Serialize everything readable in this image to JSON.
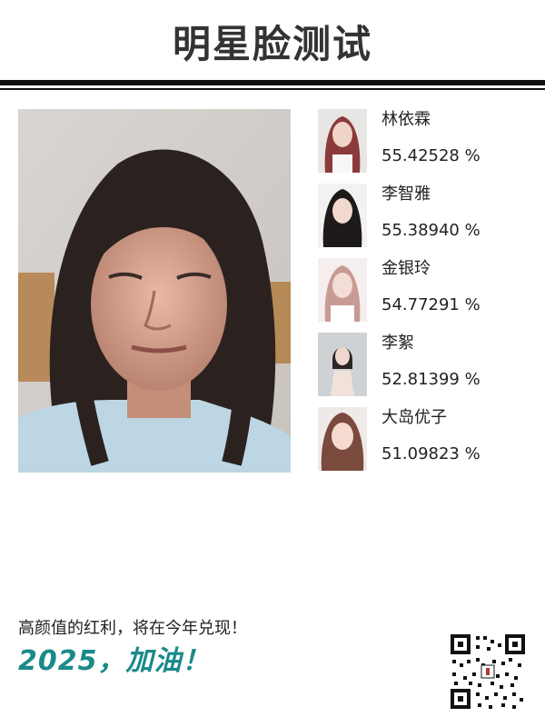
{
  "header": {
    "title": "明星脸测试"
  },
  "matches": [
    {
      "name": "林依霖",
      "score": "55.42528 %"
    },
    {
      "name": "李智雅",
      "score": "55.38940 %"
    },
    {
      "name": "金银玲",
      "score": "54.77291 %"
    },
    {
      "name": "李絮",
      "score": "52.81399 %"
    },
    {
      "name": "大岛优子",
      "score": "51.09823 %"
    }
  ],
  "footer": {
    "slogan": "高颜值的红利，将在今年兑现！",
    "cheer": "2025，加油！"
  },
  "colors": {
    "cheer": "#1a8a8a",
    "title": "#333333"
  }
}
